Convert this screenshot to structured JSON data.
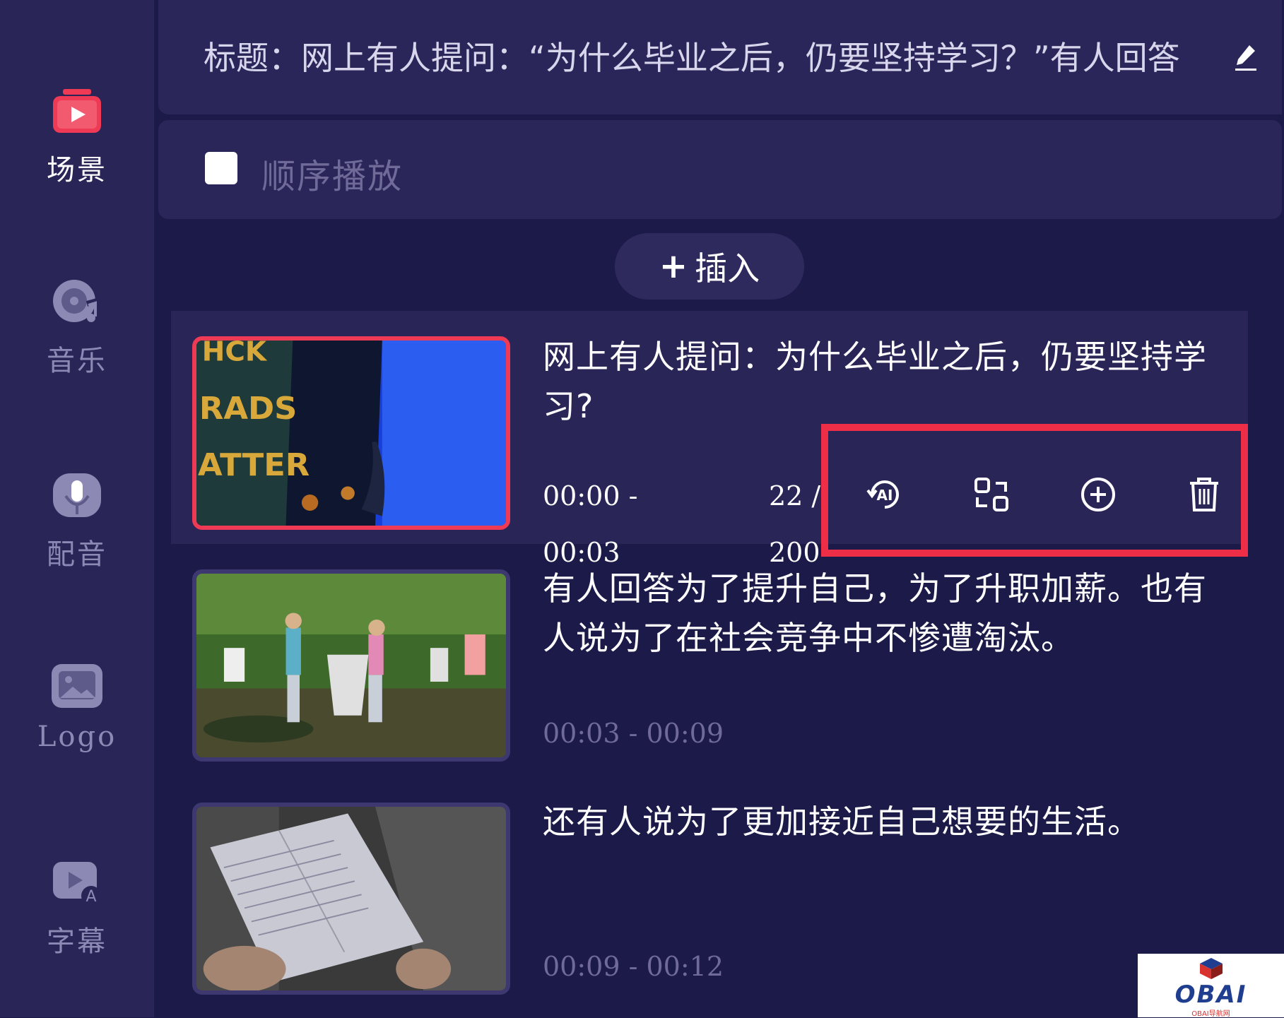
{
  "sidebar": {
    "items": [
      {
        "label": "场景",
        "icon": "video-play-icon",
        "active": true
      },
      {
        "label": "音乐",
        "icon": "music-disc-icon"
      },
      {
        "label": "配音",
        "icon": "microphone-icon"
      },
      {
        "label": "Logo",
        "icon": "image-icon"
      },
      {
        "label": "字幕",
        "icon": "subtitle-icon"
      }
    ]
  },
  "header": {
    "title": "标题：网上有人提问：“为什么毕业之后，仍要坚持学习？”有人回答"
  },
  "sequential": {
    "label": "顺序播放",
    "checked": false
  },
  "insert": {
    "plus": "+",
    "label": "插入"
  },
  "scenes": [
    {
      "text": "网上有人提问：为什么毕业之后，仍要坚持学习?",
      "time_start": "00:00 -",
      "time_end": "00:03",
      "count_a": "22 /",
      "count_b": "200",
      "selected": true
    },
    {
      "text": "有人回答为了提升自己，为了升职加薪。也有人说为了在社会竞争中不惨遭淘汰。",
      "time": "00:03 - 00:09"
    },
    {
      "text": "还有人说为了更加接近自己想要的生活。",
      "time": "00:09 - 00:12"
    }
  ],
  "actions": [
    "ai-rewrite-icon",
    "replace-icon",
    "add-circle-icon",
    "trash-icon"
  ],
  "watermark": {
    "brand": "OBAI",
    "sub": "OBAI导航网"
  },
  "colors": {
    "background": "#1c1a48",
    "sidebar": "#2a2557",
    "accent": "#ef3a55",
    "highlight_box": "#ee2d46",
    "muted_text": "#6f6a98"
  }
}
